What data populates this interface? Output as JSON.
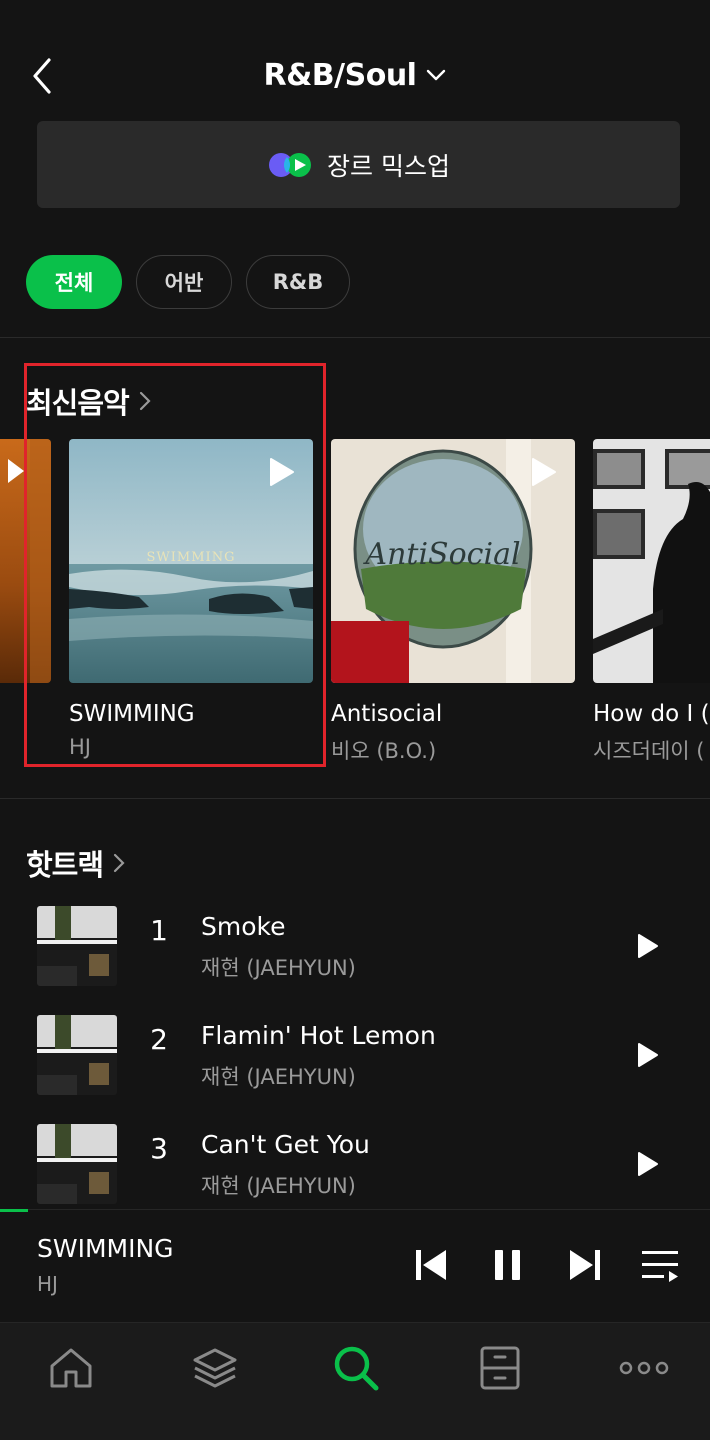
{
  "header": {
    "title": "R&B/Soul",
    "back_icon": "chevron-left-icon",
    "dropdown_icon": "chevron-down-icon"
  },
  "mixup": {
    "label": "장르 믹스업",
    "icon": "mixup-logo-icon"
  },
  "filters": [
    {
      "label": "전체",
      "active": true
    },
    {
      "label": "어반",
      "active": false
    },
    {
      "label": "R&B",
      "active": false
    }
  ],
  "latest": {
    "title": "최신음악",
    "albums": [
      {
        "title": "SWIMMING",
        "artist": "HJ"
      },
      {
        "title": "Antisocial",
        "artist": "비오 (B.O.)"
      },
      {
        "title": "How do I (",
        "artist": "시즈더데이 ("
      }
    ]
  },
  "hot_tracks": {
    "title": "핫트랙",
    "tracks": [
      {
        "rank": "1",
        "title": "Smoke",
        "artist": "재현 (JAEHYUN)"
      },
      {
        "rank": "2",
        "title": "Flamin' Hot Lemon",
        "artist": "재현 (JAEHYUN)"
      },
      {
        "rank": "3",
        "title": "Can't Get You",
        "artist": "재현 (JAEHYUN)"
      }
    ]
  },
  "now_playing": {
    "title": "SWIMMING",
    "artist": "HJ",
    "progress": 0.04
  },
  "nav": [
    {
      "icon": "home-icon"
    },
    {
      "icon": "library-layers-icon"
    },
    {
      "icon": "search-icon",
      "active": true
    },
    {
      "icon": "storage-drawer-icon"
    },
    {
      "icon": "more-icon"
    }
  ],
  "colors": {
    "accent": "#0ac04a",
    "background": "#141414",
    "highlight": "#e0242b"
  }
}
